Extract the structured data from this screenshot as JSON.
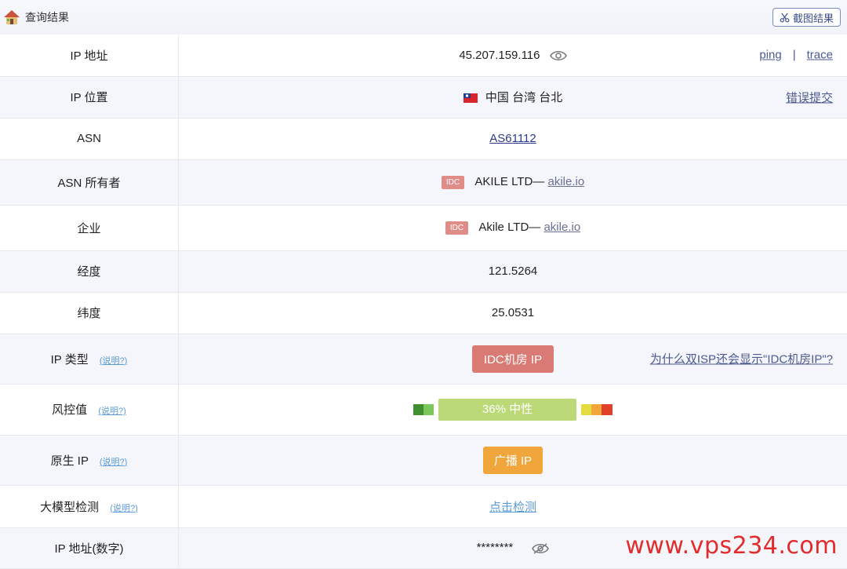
{
  "header": {
    "title": "查询结果",
    "screenshot_button": "截图结果"
  },
  "rows": {
    "ip": {
      "label": "IP 地址",
      "value": "45.207.159.116",
      "ping": "ping",
      "sep": "|",
      "trace": "trace"
    },
    "location": {
      "label": "IP 位置",
      "value": "中国 台湾 台北",
      "report": "错误提交"
    },
    "asn": {
      "label": "ASN",
      "value": "AS61112"
    },
    "asn_owner": {
      "label": "ASN 所有者",
      "badge": "IDC",
      "name": "AKILE LTD—",
      "domain": "akile.io"
    },
    "company": {
      "label": "企业",
      "badge": "IDC",
      "name": "Akile LTD—",
      "domain": "akile.io"
    },
    "longitude": {
      "label": "经度",
      "value": "121.5264"
    },
    "latitude": {
      "label": "纬度",
      "value": "25.0531"
    },
    "ip_type": {
      "label": "IP 类型",
      "hint": "(说明?)",
      "value": "IDC机房 IP",
      "question": "为什么双ISP还会显示\"IDC机房IP\"?"
    },
    "risk": {
      "label": "风控值",
      "hint": "(说明?)",
      "value": "36%  中性",
      "level": 0.36
    },
    "native": {
      "label": "原生 IP",
      "hint": "(说明?)",
      "value": "广播 IP"
    },
    "llm": {
      "label": "大模型检测",
      "hint": "(说明?)",
      "value": "点击检测"
    },
    "ip_number": {
      "label": "IP 地址(数字)",
      "value": "********"
    }
  },
  "watermark": "www.vps234.com",
  "colors": {
    "accent": "#4b5a8f",
    "idc_badge": "#e08c88",
    "ip_type_button": "#d97a74",
    "native_button": "#f0a63b",
    "risk_bar": "#bbd977",
    "watermark": "#e22b2b"
  },
  "icons": {
    "home": "house-icon",
    "scissors": "scissors-icon",
    "eye": "eye-icon",
    "eye_off": "eye-off-icon",
    "flag": "taiwan-flag-icon"
  }
}
